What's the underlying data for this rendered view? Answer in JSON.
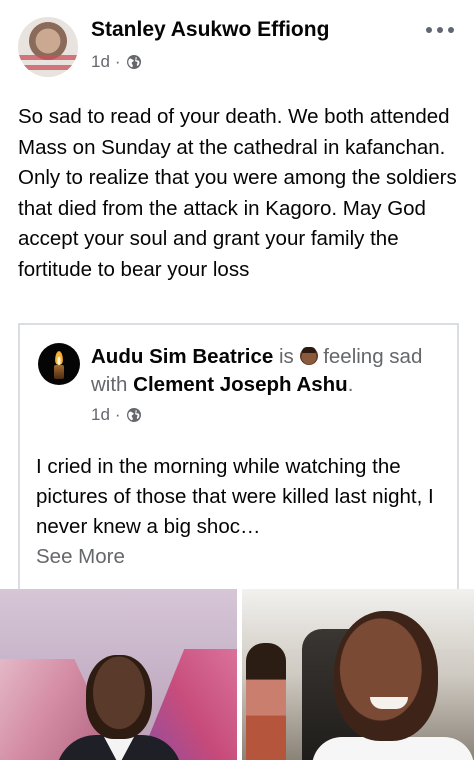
{
  "post": {
    "author": "Stanley Asukwo Effiong",
    "time": "1d",
    "separator": "·",
    "text": "So sad to read of your death. We both attended Mass on Sunday at the cathedral in kafanchan. Only to realize that you were among the soldiers that died from the attack in Kagoro. May God accept your soul and grant your family the fortitude to bear your loss",
    "privacy_icon": "globe-icon",
    "menu_icon": "more-horizontal-icon"
  },
  "shared_post": {
    "author": "Audu Sim Beatrice",
    "is_word": "is",
    "feeling_text": "feeling sad with",
    "tagged": "Clement Joseph Ashu",
    "period": ".",
    "time": "1d",
    "separator": "·",
    "text": "I cried in the morning while watching the pictures of those that were killed last night, I never knew a big shoc…",
    "see_more": "See More",
    "emoji_icon": "sad-face-emoji-icon",
    "avatar_icon": "candle-icon"
  },
  "photos": [
    {
      "name": "photo-man-in-church"
    },
    {
      "name": "photo-man-in-car"
    }
  ],
  "colors": {
    "text": "#050505",
    "secondary_text": "#65676b",
    "border": "#dadde1",
    "background": "#ffffff"
  }
}
